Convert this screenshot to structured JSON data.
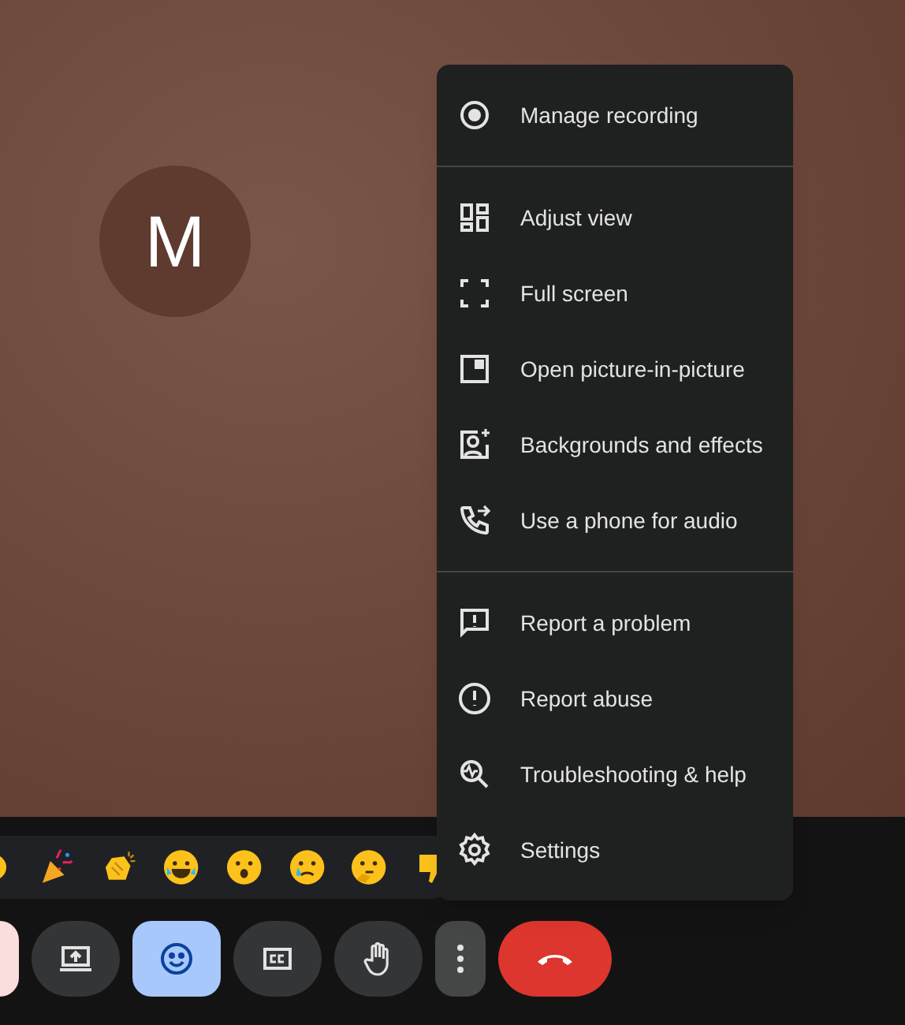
{
  "participant": {
    "initial": "M"
  },
  "menu": {
    "sections": [
      {
        "items": [
          {
            "kind": "record",
            "label": "Manage recording"
          }
        ]
      },
      {
        "items": [
          {
            "kind": "layout",
            "label": "Adjust view"
          },
          {
            "kind": "fullscreen",
            "label": "Full screen"
          },
          {
            "kind": "pip",
            "label": "Open picture-in-picture"
          },
          {
            "kind": "background",
            "label": "Backgrounds and effects"
          },
          {
            "kind": "phone",
            "label": "Use a phone for audio"
          }
        ]
      },
      {
        "items": [
          {
            "kind": "report",
            "label": "Report a problem"
          },
          {
            "kind": "abuse",
            "label": "Report abuse"
          },
          {
            "kind": "help",
            "label": "Troubleshooting & help"
          },
          {
            "kind": "settings",
            "label": "Settings"
          }
        ]
      }
    ]
  },
  "controls": [
    {
      "kind": "muted",
      "selected": false
    },
    {
      "kind": "present",
      "selected": false
    },
    {
      "kind": "reactions",
      "selected": true
    },
    {
      "kind": "captions",
      "selected": false
    },
    {
      "kind": "hand",
      "selected": false
    },
    {
      "kind": "more",
      "selected": false
    },
    {
      "kind": "hangup",
      "selected": false
    }
  ]
}
